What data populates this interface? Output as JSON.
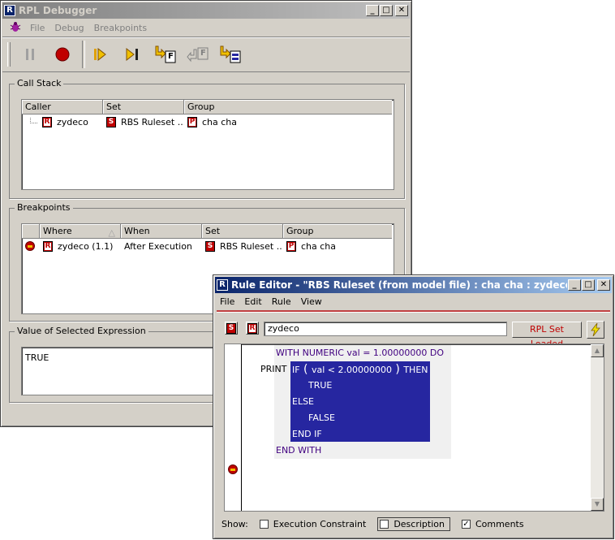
{
  "debugger": {
    "title": "RPL Debugger",
    "menu": [
      "File",
      "Debug",
      "Breakpoints"
    ],
    "toolbar": {
      "pause": "pause-icon",
      "stop": "stop-icon",
      "run_to": "step-into-icon",
      "step": "step-over-icon",
      "step_f1": "F",
      "step_f2": "F"
    },
    "call_stack": {
      "label": "Call Stack",
      "columns": [
        "Caller",
        "Set",
        "Group"
      ],
      "rows": [
        {
          "caller": "zydeco",
          "set": "RBS Ruleset ...",
          "group": "cha cha"
        }
      ]
    },
    "breakpoints": {
      "label": "Breakpoints",
      "columns": [
        "Where",
        "When",
        "Set",
        "Group"
      ],
      "rows": [
        {
          "where": "zydeco (1.1)",
          "when": "After Execution",
          "set": "RBS Ruleset ...",
          "group": "cha cha"
        }
      ]
    },
    "expression": {
      "label": "Value of Selected Expression",
      "value": "TRUE"
    }
  },
  "editor": {
    "title": "Rule Editor - \"RBS Ruleset (from model file) : cha cha : zydeco\"",
    "menu": [
      "File",
      "Edit",
      "Rule",
      "View"
    ],
    "badge_s": "S",
    "badge_r": "R",
    "rule_name": "zydeco",
    "status_button": "RPL Set Loaded",
    "code": {
      "print": "PRINT",
      "with_line": "WITH NUMERIC val = 1.00000000 DO",
      "if_kw": "IF",
      "cond": "val < 2.00000000",
      "then_kw": "THEN",
      "true_val": "TRUE",
      "else_kw": "ELSE",
      "false_val": "FALSE",
      "endif_kw": "END IF",
      "endwith_kw": "END WITH"
    },
    "show": {
      "label": "Show:",
      "execution_constraint": "Execution Constraint",
      "description": "Description",
      "comments": "Comments",
      "comments_checked": "✓"
    }
  }
}
